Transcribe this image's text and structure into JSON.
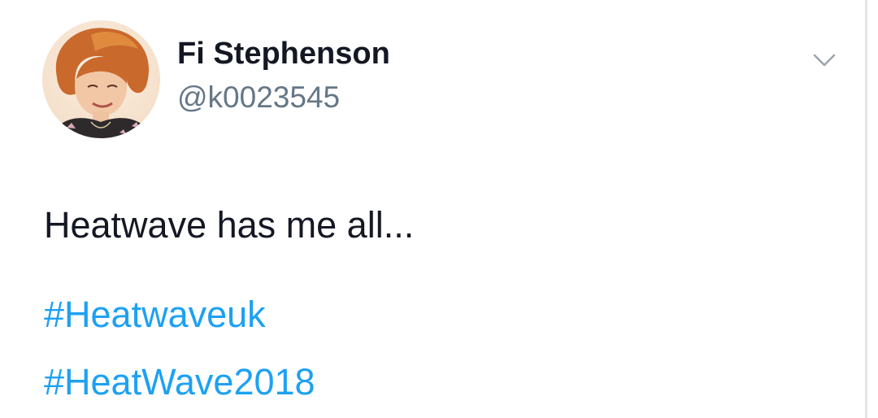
{
  "tweet": {
    "author": {
      "display_name": "Fi Stephenson",
      "handle": "@k0023545",
      "avatar_icon": "profile-photo"
    },
    "text": "Heatwave has me all...",
    "hashtags": [
      "#Heatwaveuk",
      "#HeatWave2018"
    ],
    "menu_icon": "chevron-down-icon"
  },
  "colors": {
    "text": "#141823",
    "secondary": "#657786",
    "link": "#1da1f2"
  }
}
